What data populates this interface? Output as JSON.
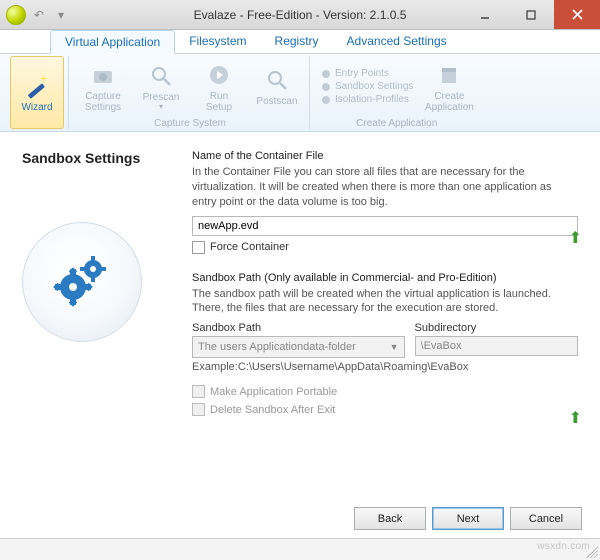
{
  "title": "Evalaze - Free-Edition - Version: 2.1.0.5",
  "tabs": {
    "virtual_app": "Virtual Application",
    "filesystem": "Filesystem",
    "registry": "Registry",
    "advanced": "Advanced Settings"
  },
  "ribbon": {
    "wizard": "Wizard",
    "capture_settings": "Capture\nSettings",
    "prescan": "Prescan",
    "run_setup": "Run\nSetup",
    "postscan": "Postscan",
    "group_capture": "Capture System",
    "entry_points": "Entry Points",
    "sandbox_settings": "Sandbox Settings",
    "isolation_profiles": "Isolation-Profiles",
    "group_create": "Create Application",
    "create_app": "Create\nApplication"
  },
  "page": {
    "heading": "Sandbox Settings",
    "container_title": "Name of the Container File",
    "container_desc": "In the Container File you can store all files that are necessary for the virtualization. It will be created when there is more than one application as entry point or the data volume is too big.",
    "container_value": "newApp.evd",
    "force_container": "Force Container",
    "sandbox_title": "Sandbox Path (Only available in Commercial- and Pro-Edition)",
    "sandbox_desc": "The sandbox path will be created when the virtual application is launched. There, the files that are necessary for the execution are stored.",
    "col_sandbox": "Sandbox Path",
    "col_subdir": "Subdirectory",
    "sandbox_value": "The users Applicationdata-folder",
    "subdir_value": "\\EvaBox",
    "example": "Example:C:\\Users\\Username\\AppData\\Roaming\\EvaBox",
    "make_portable": "Make Application Portable",
    "delete_after": "Delete Sandbox After Exit"
  },
  "buttons": {
    "back": "Back",
    "next": "Next",
    "cancel": "Cancel"
  },
  "watermark": "wsxdn.com"
}
